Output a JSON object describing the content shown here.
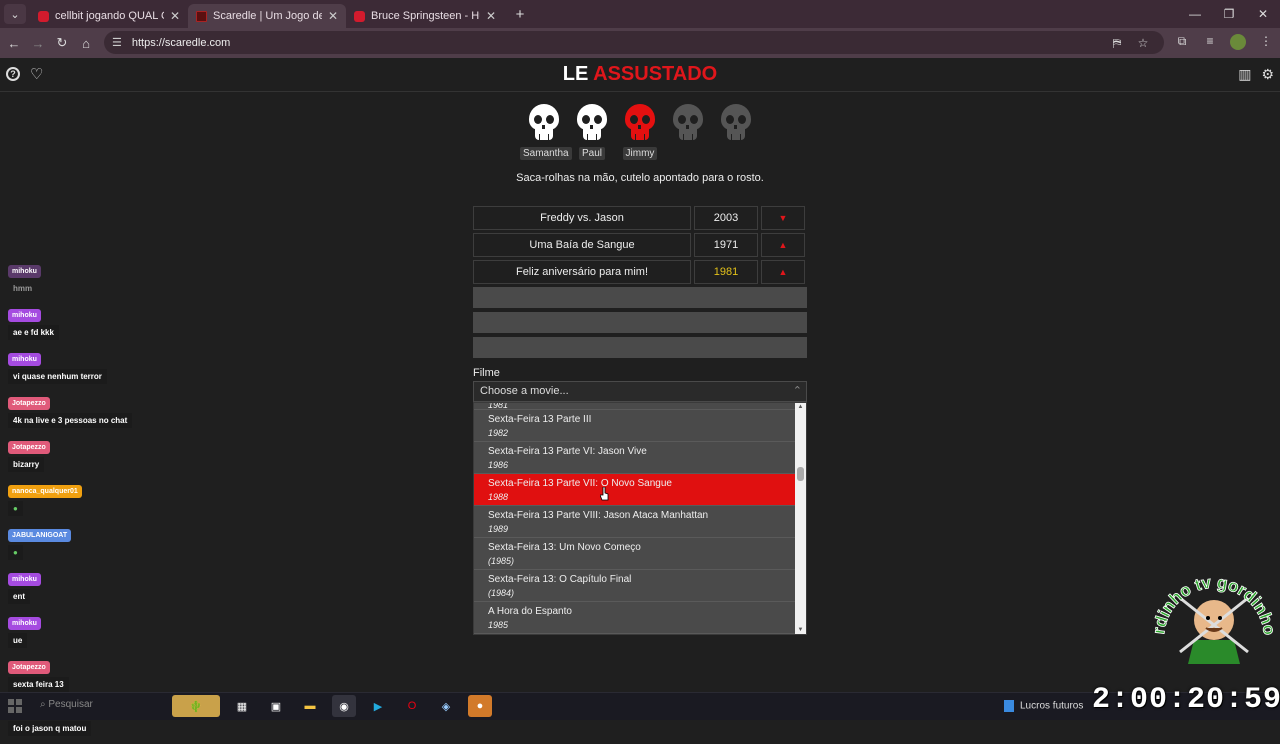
{
  "browser": {
    "tabs": [
      {
        "title": "cellbit jogando QUAL O MAIS P",
        "active": false
      },
      {
        "title": "Scaredle | Um Jogo de Terror D",
        "active": true
      },
      {
        "title": "Bruce Springsteen - Hungry He",
        "active": false
      }
    ],
    "url": "https://scaredle.com"
  },
  "site": {
    "logo_le": "LE",
    "logo_assustado": "ASSUSTADO",
    "victims": [
      {
        "name": "Samantha",
        "state": "white"
      },
      {
        "name": "Paul",
        "state": "white"
      },
      {
        "name": "Jimmy",
        "state": "red"
      },
      {
        "name": "",
        "state": "grey"
      },
      {
        "name": "",
        "state": "grey"
      }
    ],
    "clue": "Saca-rolhas na mão, cutelo apontado para o rosto.",
    "guesses": [
      {
        "title": "Freddy vs. Jason",
        "year": "2003",
        "arrow": "▼",
        "year_color": "normal"
      },
      {
        "title": "Uma Baía de Sangue",
        "year": "1971",
        "arrow": "▲",
        "year_color": "normal"
      },
      {
        "title": "Feliz aniversário para mim!",
        "year": "1981",
        "arrow": "▲",
        "year_color": "gold"
      }
    ],
    "filme_label": "Filme",
    "select_placeholder": "Choose a movie...",
    "options": [
      {
        "name": "",
        "year": "1981"
      },
      {
        "name": "Sexta-Feira 13 Parte III",
        "year": "1982"
      },
      {
        "name": "Sexta-Feira 13 Parte VI: Jason Vive",
        "year": "1986"
      },
      {
        "name": "Sexta-Feira 13 Parte VII: O Novo Sangue",
        "year": "1988"
      },
      {
        "name": "Sexta-Feira 13 Parte VIII: Jason Ataca Manhattan",
        "year": "1989"
      },
      {
        "name": "Sexta-Feira 13: Um Novo Começo",
        "year": "(1985)"
      },
      {
        "name": "Sexta-Feira 13: O Capítulo Final",
        "year": "(1984)"
      },
      {
        "name": "A Hora do Espanto",
        "year": "1985"
      }
    ],
    "selected_index": 3
  },
  "chat": [
    {
      "user": "mihoku",
      "text": "hmm",
      "color": "#5a3a6a",
      "dim": true
    },
    {
      "user": "mihoku",
      "text": "ae e fd kkk",
      "color": "#a54be0"
    },
    {
      "user": "mihoku",
      "text": "vi quase nenhum terror",
      "color": "#a54be0"
    },
    {
      "user": "Jotapezzo",
      "text": "4k na live e 3 pessoas no chat",
      "color": "#e05a7a"
    },
    {
      "user": "Jotapezzo",
      "text": "bizarry",
      "color": "#e05a7a"
    },
    {
      "user": "nanoca_qualquer01",
      "text": "",
      "color": "#f0a010"
    },
    {
      "user": "JABULANIGOAT",
      "text": "",
      "color": "#5a8ae0"
    },
    {
      "user": "mihoku",
      "text": "ent",
      "color": "#a54be0"
    },
    {
      "user": "mihoku",
      "text": "ue",
      "color": "#a54be0"
    },
    {
      "user": "Jotapezzo",
      "text": "sexta feira 13",
      "color": "#e05a7a"
    },
    {
      "user": "Jotapezzo",
      "text": "foi o jason q matou",
      "color": "#e05a7a"
    }
  ],
  "taskbar": {
    "search": "Pesquisar",
    "news": "Lucros futuros"
  },
  "overlay": {
    "clock": "2:00:20:59",
    "watermark": "gordinho tv gordinho tv"
  },
  "colors": {
    "accent_red": "#e0161b",
    "selected_bg": "#e01010",
    "gold_year": "#e2c11a"
  }
}
